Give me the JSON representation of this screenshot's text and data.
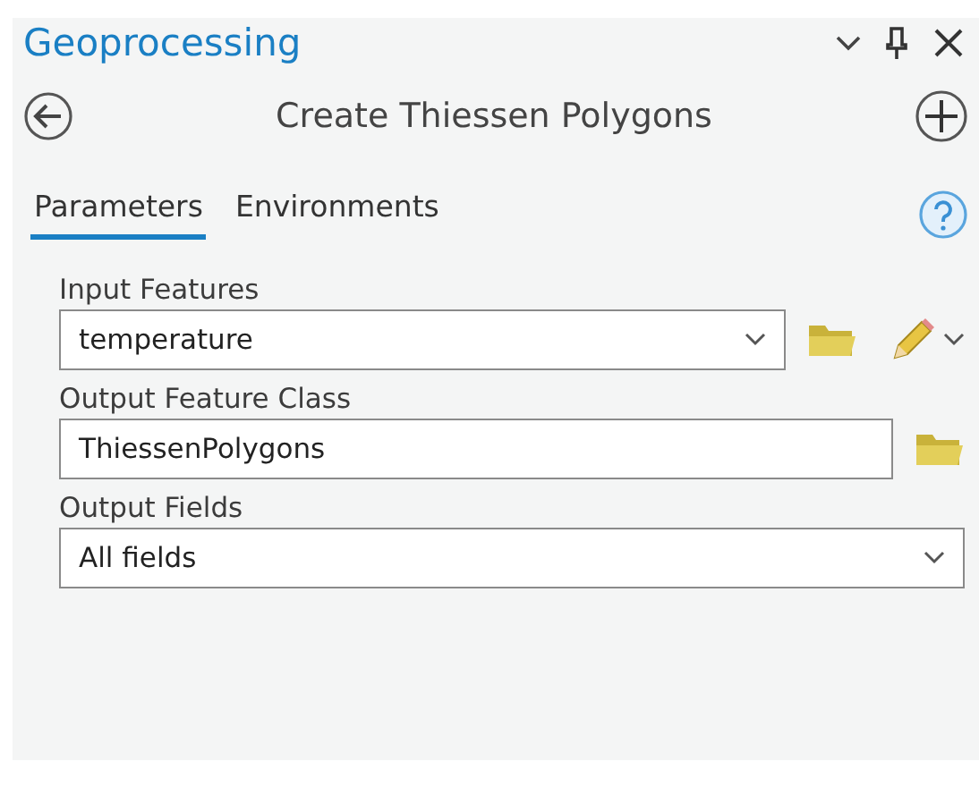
{
  "pane": {
    "title": "Geoprocessing"
  },
  "tool": {
    "title": "Create Thiessen Polygons"
  },
  "tabs": [
    {
      "label": "Parameters",
      "selected": true
    },
    {
      "label": "Environments",
      "selected": false
    }
  ],
  "parameters": [
    {
      "label": "Input Features",
      "value": "temperature",
      "kind": "dropdown",
      "browse": true,
      "sketch": true
    },
    {
      "label": "Output Feature Class",
      "value": "ThiessenPolygons",
      "kind": "text",
      "browse": true,
      "sketch": false
    },
    {
      "label": "Output Fields",
      "value": "All fields",
      "kind": "dropdown",
      "browse": false,
      "sketch": false
    }
  ]
}
